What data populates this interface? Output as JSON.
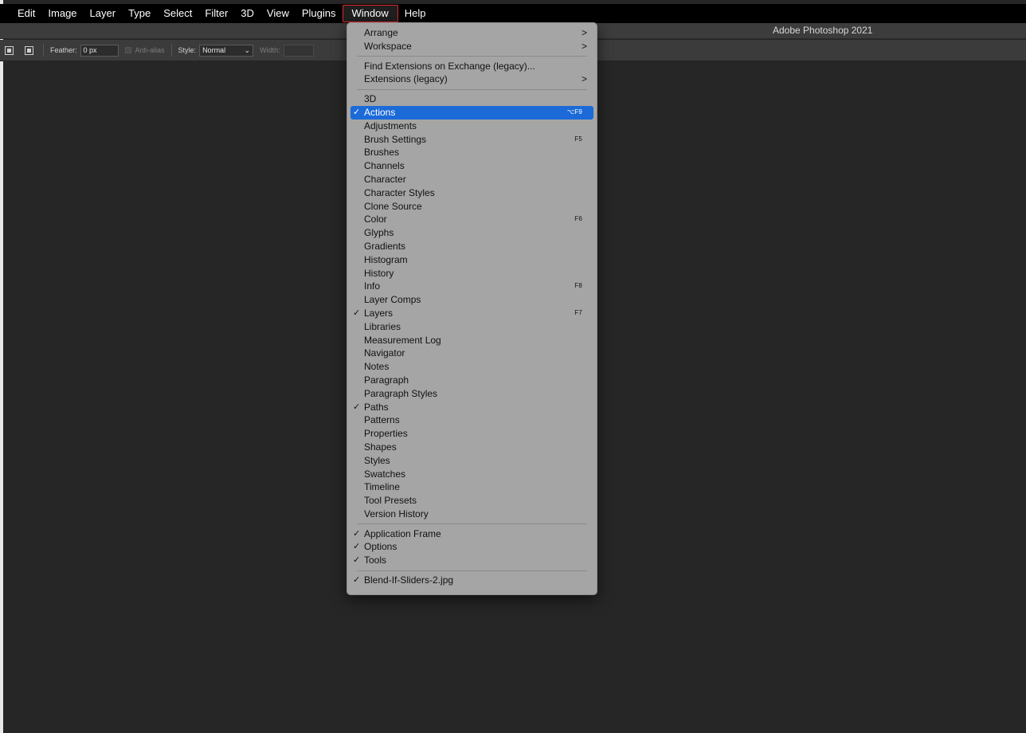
{
  "menubar": {
    "items": [
      {
        "label": "Edit"
      },
      {
        "label": "Image"
      },
      {
        "label": "Layer"
      },
      {
        "label": "Type"
      },
      {
        "label": "Select"
      },
      {
        "label": "Filter"
      },
      {
        "label": "3D"
      },
      {
        "label": "View"
      },
      {
        "label": "Plugins"
      },
      {
        "label": "Window"
      },
      {
        "label": "Help"
      }
    ],
    "open_menu": "Window"
  },
  "app": {
    "title": "Adobe Photoshop 2021"
  },
  "options": {
    "feather_label": "Feather:",
    "feather_value": "0 px",
    "antialias_label": "Anti-alias",
    "style_label": "Style:",
    "style_value": "Normal",
    "width_label": "Width:"
  },
  "window_menu": {
    "arrange": "Arrange",
    "workspace": "Workspace",
    "find_extensions": "Find Extensions on Exchange (legacy)...",
    "extensions": "Extensions (legacy)",
    "item_3d": "3D",
    "actions": "Actions",
    "actions_shortcut": "⌥F9",
    "adjustments": "Adjustments",
    "brush_settings": "Brush Settings",
    "brush_settings_shortcut": "F5",
    "brushes": "Brushes",
    "channels": "Channels",
    "character": "Character",
    "character_styles": "Character Styles",
    "clone_source": "Clone Source",
    "color": "Color",
    "color_shortcut": "F6",
    "glyphs": "Glyphs",
    "gradients": "Gradients",
    "histogram": "Histogram",
    "history": "History",
    "info": "Info",
    "info_shortcut": "F8",
    "layer_comps": "Layer Comps",
    "layers": "Layers",
    "layers_shortcut": "F7",
    "libraries": "Libraries",
    "measurement_log": "Measurement Log",
    "navigator": "Navigator",
    "notes": "Notes",
    "paragraph": "Paragraph",
    "paragraph_styles": "Paragraph Styles",
    "paths": "Paths",
    "patterns": "Patterns",
    "properties": "Properties",
    "shapes": "Shapes",
    "styles": "Styles",
    "swatches": "Swatches",
    "timeline": "Timeline",
    "tool_presets": "Tool Presets",
    "version_history": "Version History",
    "application_frame": "Application Frame",
    "options_item": "Options",
    "tools": "Tools",
    "document": "Blend-If-Sliders-2.jpg",
    "check_glyph": "✓",
    "submenu_glyph": ">"
  },
  "colors": {
    "highlight": "#1b6ad8",
    "canvas": "#262626",
    "menu_bg": "#a5a5a5",
    "open_menu_outline": "#e0282e"
  }
}
